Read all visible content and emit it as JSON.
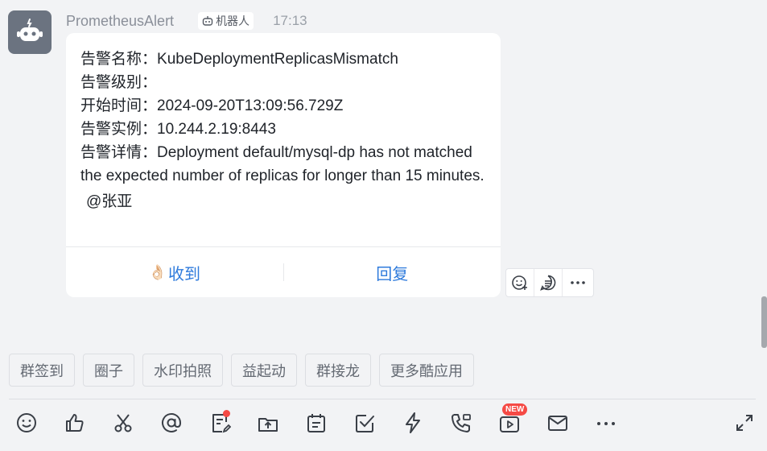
{
  "message": {
    "sender": "PrometheusAlert",
    "bot_tag": "机器人",
    "time": "17:13",
    "avatar_icon": "robot-icon"
  },
  "card": {
    "lines": [
      {
        "label": "告警名称：",
        "value": "KubeDeploymentReplicasMismatch"
      },
      {
        "label": "告警级别：",
        "value": ""
      },
      {
        "label": "开始时间：",
        "value": "2024-09-20T13:09:56.729Z"
      },
      {
        "label": "告警实例：",
        "value": "10.244.2.19:8443"
      },
      {
        "label": "告警详情：",
        "value": "Deployment default/mysql-dp has not matched the expected number of replicas for longer than 15 minutes."
      }
    ],
    "mention": "@张亚",
    "actions": {
      "receive": "收到",
      "receive_emoji": "👌🏻",
      "reply": "回复"
    },
    "accent_color": "#2f7bdc"
  },
  "message_tools": [
    "emoji-reaction-icon",
    "thread-reply-icon",
    "more-icon"
  ],
  "apps": [
    "群签到",
    "圈子",
    "水印拍照",
    "益起动",
    "群接龙",
    "更多酷应用"
  ],
  "toolbar": {
    "new_badge": "NEW",
    "icons": [
      "emoji-icon",
      "like-icon",
      "scissors-icon",
      "at-icon",
      "doc-edit-icon",
      "upload-icon",
      "calendar-icon",
      "task-check-icon",
      "lightning-icon",
      "call-icon",
      "live-icon",
      "mail-icon",
      "more-icon"
    ],
    "expand_icon": "expand-icon"
  }
}
